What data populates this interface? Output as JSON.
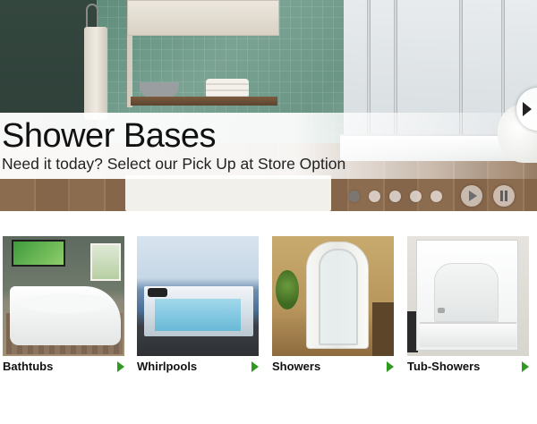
{
  "hero": {
    "title": "Shower Bases",
    "subtitle": "Need it today? Select our Pick Up at Store Option",
    "slide_count": 5,
    "active_slide": 1
  },
  "categories": [
    {
      "label": "Bathtubs",
      "icon": "green-chevron-right-icon"
    },
    {
      "label": "Whirlpools",
      "icon": "green-chevron-right-icon"
    },
    {
      "label": "Showers",
      "icon": "green-chevron-right-icon"
    },
    {
      "label": "Tub-Showers",
      "icon": "green-chevron-right-icon"
    }
  ],
  "colors": {
    "arrow_accent": "#2e9b1f",
    "text": "#111111"
  }
}
